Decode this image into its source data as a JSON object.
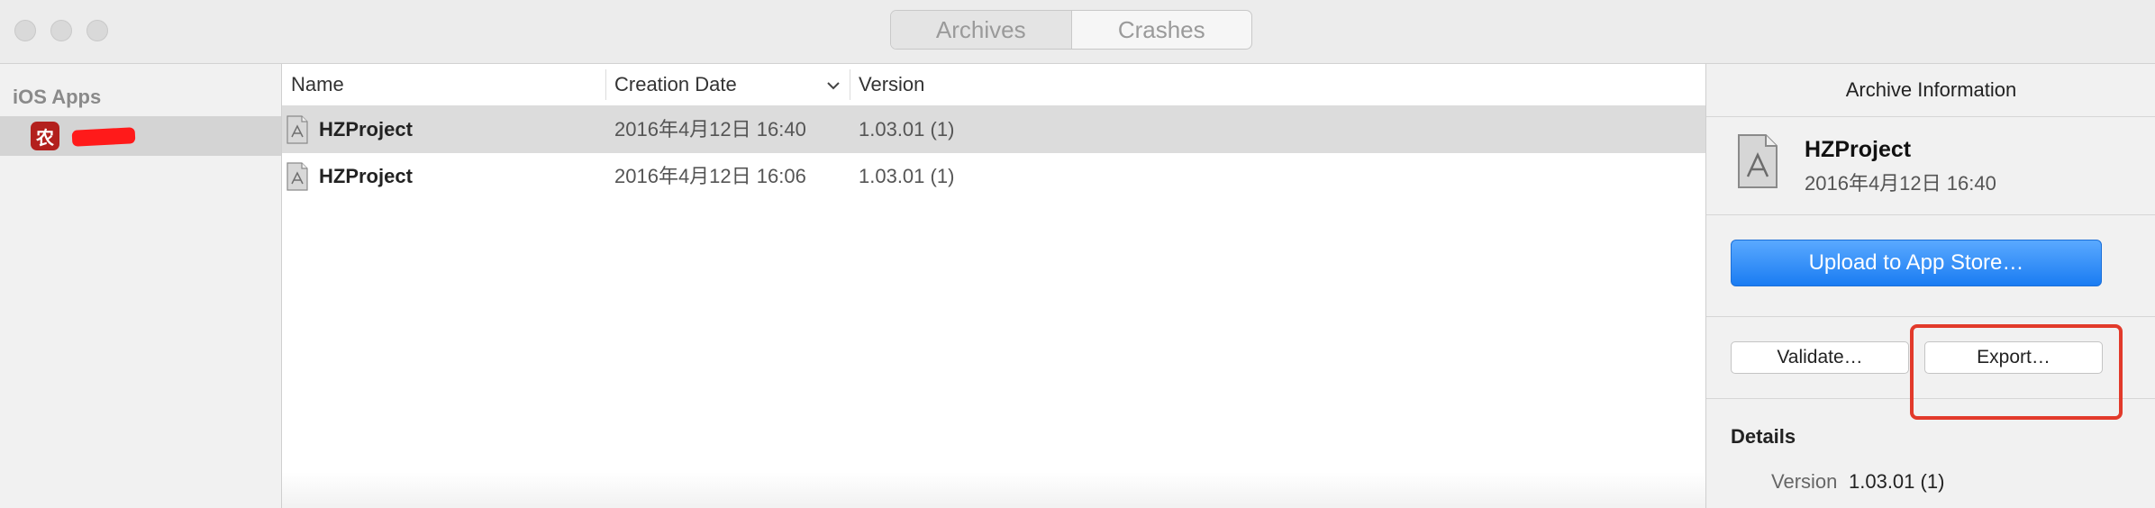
{
  "toolbar": {
    "tabs": [
      {
        "label": "Archives",
        "selected": true
      },
      {
        "label": "Crashes",
        "selected": false
      }
    ]
  },
  "sidebar": {
    "heading": "iOS Apps",
    "app": {
      "icon_glyph": "农",
      "name": "",
      "icon_color": "#b3201d"
    }
  },
  "list": {
    "columns": {
      "name": "Name",
      "creation_date": "Creation Date",
      "version": "Version"
    },
    "rows": [
      {
        "name": "HZProject",
        "date": "2016年4月12日 16:40",
        "version": "1.03.01 (1)",
        "selected": true
      },
      {
        "name": "HZProject",
        "date": "2016年4月12日 16:06",
        "version": "1.03.01 (1)",
        "selected": false
      }
    ]
  },
  "inspector": {
    "header": "Archive Information",
    "summary": {
      "name": "HZProject",
      "date": "2016年4月12日 16:40"
    },
    "upload_label": "Upload to App Store…",
    "validate_label": "Validate…",
    "export_label": "Export…",
    "details": {
      "heading": "Details",
      "version_label": "Version",
      "version_value": "1.03.01 (1)"
    }
  },
  "colors": {
    "accent": "#1a7cf2",
    "highlight": "#e23a2b",
    "selection": "#dcdcdc"
  }
}
